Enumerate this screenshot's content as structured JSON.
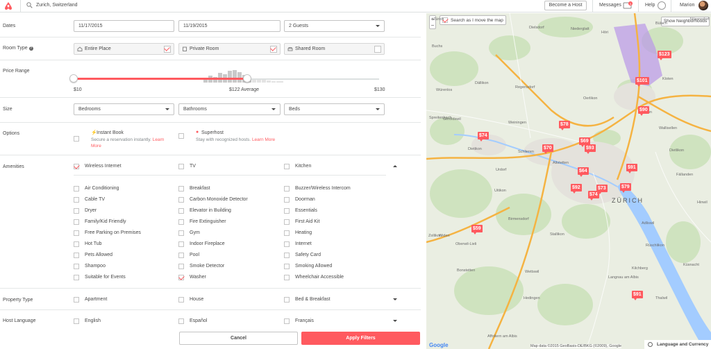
{
  "topbar": {
    "search_text": "Zurich, Switzerland",
    "become_host": "Become a Host",
    "messages": "Messages",
    "messages_badge": "1",
    "help": "Help",
    "user": "Marion"
  },
  "filters": {
    "dates": {
      "label": "Dates",
      "checkin": "11/17/2015",
      "checkout": "11/19/2015",
      "guests": "2 Guests"
    },
    "room_type": {
      "label": "Room Type",
      "options": [
        {
          "label": "Entire Place",
          "checked": true
        },
        {
          "label": "Private Room",
          "checked": true
        },
        {
          "label": "Shared Room",
          "checked": false
        }
      ]
    },
    "price": {
      "label": "Price Range",
      "min": "$10",
      "avg": "$122 Average",
      "max": "$130",
      "selected_fraction_low": 0,
      "selected_fraction_high": 0.57
    },
    "size": {
      "label": "Size",
      "bedrooms": "Bedrooms",
      "bathrooms": "Bathrooms",
      "beds": "Beds"
    },
    "options": {
      "label": "Options",
      "instant_title": "Instant Book",
      "instant_desc": "Secure a reservation instantly.",
      "instant_link1": "Learn",
      "instant_link2": "More",
      "superhost_title": "Superhost",
      "superhost_desc": "Stay with recognized hosts.",
      "superhost_link": "Learn More"
    },
    "amenities": {
      "label": "Amenities",
      "top": [
        {
          "label": "Wireless Internet",
          "checked": true
        },
        {
          "label": "TV",
          "checked": false
        },
        {
          "label": "Kitchen",
          "checked": false
        }
      ],
      "col1": [
        "Air Conditioning",
        "Cable TV",
        "Dryer",
        "Family/Kid Friendly",
        "Free Parking on Premises",
        "Hot Tub",
        "Pets Allowed",
        "Shampoo",
        "Suitable for Events"
      ],
      "col2": [
        "Breakfast",
        "Carbon Monoxide Detector",
        "Elevator in Building",
        "Fire Extinguisher",
        "Gym",
        "Indoor Fireplace",
        "Pool",
        "Smoke Detector",
        "Washer"
      ],
      "col3": [
        "Buzzer/Wireless Intercom",
        "Doorman",
        "Essentials",
        "First Aid Kit",
        "Heating",
        "Internet",
        "Safety Card",
        "Smoking Allowed",
        "Wheelchair Accessible"
      ],
      "washer_checked": true
    },
    "property_type": {
      "label": "Property Type",
      "options": [
        "Apartment",
        "House",
        "Bed & Breakfast"
      ]
    },
    "host_language": {
      "label": "Host Language",
      "options": [
        "English",
        "Español",
        "Français"
      ]
    },
    "cancel": "Cancel",
    "apply": "Apply Filters"
  },
  "map": {
    "zoom_in": "+",
    "zoom_out": "−",
    "search_move": "Search as I move the map",
    "show_neighborhoods": "Show Neighborhoods",
    "pins": [
      "$123",
      "$101",
      "$90",
      "$78",
      "$74",
      "$69",
      "$93",
      "$70",
      "$64",
      "$91",
      "$92",
      "$73",
      "$79",
      "$74",
      "$59",
      "$91"
    ],
    "labels": [
      "Dielsdorf",
      "Niederglatt",
      "Höri",
      "Bülach",
      "Nürensdorf",
      "Buchs",
      "Dällikon",
      "Regensdorf",
      "Opfikon",
      "Kloten",
      "Wallisellen",
      "Dietlikon",
      "Würenlos",
      "Geroldswil",
      "Weiningen",
      "Dietikon",
      "Schlieren",
      "Urdorf",
      "Birmensdorf",
      "Uitikon",
      "Adliswil",
      "Kilchberg",
      "Rüschlikon",
      "Thalwil",
      "Küsnacht",
      "Zollikon",
      "Bonstetten",
      "Hedingen",
      "Affoltern am Albis",
      "Langnau am Albis",
      "Wettswil",
      "Stallikon",
      "Widen",
      "Oberwil-Lieli",
      "Spreitenbach",
      "Oerlikon",
      "Zürich",
      "Altstetten",
      "Fällanden",
      "Hinwil"
    ],
    "city": "ZÜRICH",
    "attribution": "Map data ©2015 GeoBasis-DE/BKG (©2009), Google",
    "google": "Google",
    "language_currency": "Language and Currency"
  }
}
